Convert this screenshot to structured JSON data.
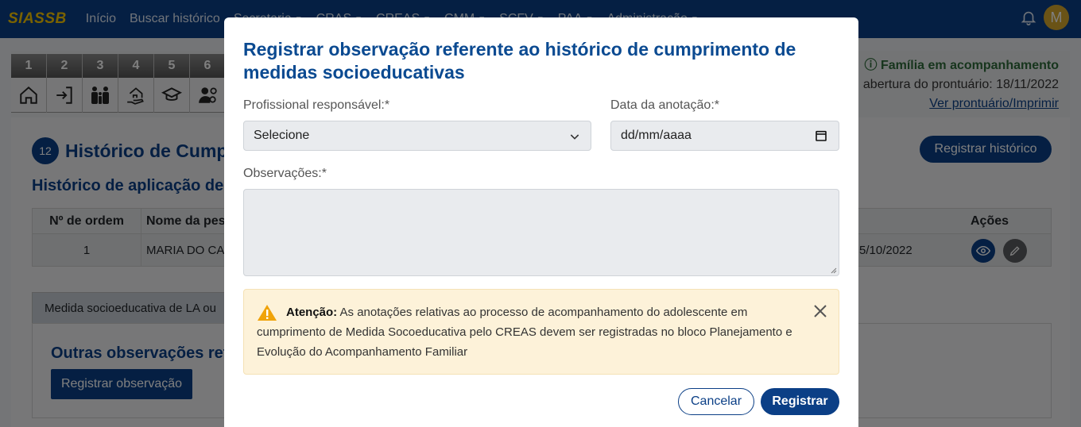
{
  "navbar": {
    "brand": "SIASSB",
    "items": [
      {
        "label": "Início",
        "dropdown": false
      },
      {
        "label": "Buscar histórico",
        "dropdown": false
      },
      {
        "label": "Secretaria",
        "dropdown": true
      },
      {
        "label": "CRAS",
        "dropdown": true
      },
      {
        "label": "CREAS",
        "dropdown": true
      },
      {
        "label": "CMM",
        "dropdown": true
      },
      {
        "label": "SCFV",
        "dropdown": true
      },
      {
        "label": "PAA",
        "dropdown": true
      },
      {
        "label": "Administração",
        "dropdown": true
      }
    ],
    "avatar_initial": "M"
  },
  "steps": [
    "1",
    "2",
    "3",
    "4",
    "5",
    "6"
  ],
  "status": {
    "family": "Família em acompanhamento",
    "opening": "abertura do prontuário: 18/11/2022",
    "link": "Ver prontuário/Imprimir"
  },
  "page": {
    "section_number": "12",
    "title": "Histórico de Cump",
    "register_history_btn": "Registrar histórico",
    "subtitle": "Histórico de aplicação de",
    "table": {
      "headers": {
        "order": "Nº de ordem",
        "name": "Nome da pes",
        "actions": "Ações"
      },
      "row": {
        "order": "1",
        "name": "MARIA DO CA",
        "date": "5/10/2022"
      }
    },
    "tab_label": "Medida socioeducativa de LA ou",
    "other_obs_title": "Outras observações refe",
    "register_obs_btn": "Registrar observação"
  },
  "modal": {
    "title": "Registrar observação referente ao histórico de cumprimento de medidas socioeducativas",
    "professional_label": "Profissional responsável:*",
    "professional_value": "Selecione",
    "date_label": "Data da anotação:*",
    "date_placeholder": "dd/mm/aaaa",
    "observations_label": "Observações:*",
    "alert_strong": "Atenção:",
    "alert_text": "As anotações relativas ao processo de acompanhamento do adolescente em cumprimento de Medida Socoeducativa pelo CREAS devem ser registradas no bloco Planejamento e Evolução do Acompanhamento Familiar",
    "cancel": "Cancelar",
    "submit": "Registrar"
  },
  "colors": {
    "primary": "#0b3f86",
    "brand": "#f5c400",
    "alert_bg": "#fdf2d9",
    "warning": "#f0a30a",
    "success": "#2e6b3a"
  },
  "icons": [
    "home-icon",
    "login-icon",
    "family-icon",
    "house-hand-icon",
    "graduation-cap-icon",
    "user-gear-icon",
    "bell-icon",
    "eye-icon",
    "pencil-icon",
    "chevron-down-icon",
    "calendar-icon",
    "warning-icon",
    "close-icon",
    "info-icon"
  ]
}
